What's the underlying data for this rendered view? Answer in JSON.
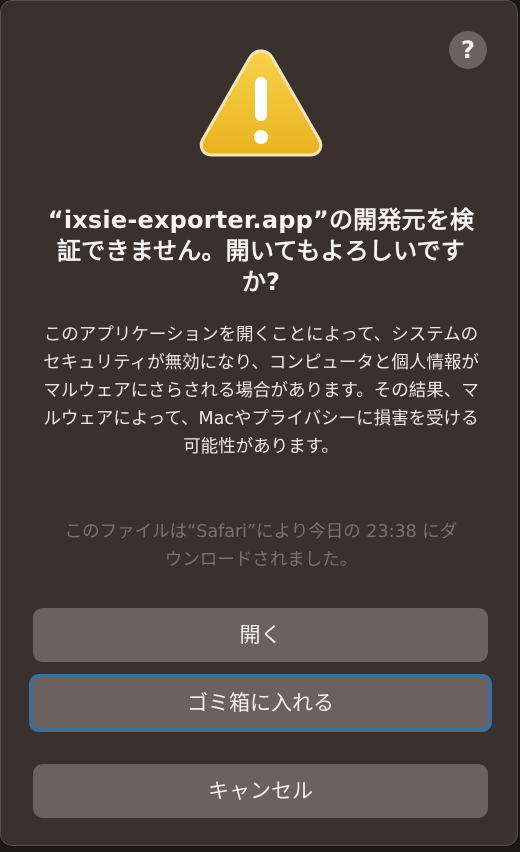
{
  "dialog": {
    "title": "“ixsie-exporter.app”の開発元を検証できません。開いてもよろしいですか?",
    "message": "このアプリケーションを開くことによって、システムのセキュリティが無効になり、コンピュータと個人情報がマルウェアにさらされる場合があります。その結果、マルウェアによって、Macやプライバシーに損害を受ける可能性があります。",
    "source_note": "このファイルは“Safari”により今日の 23:38 にダウンロードされました。",
    "help_label": "?",
    "buttons": {
      "open": "開く",
      "move_to_trash": "ゴミ箱に入れる",
      "cancel": "キャンセル"
    }
  },
  "colors": {
    "dialog_bg": "#3a302d",
    "button_bg": "#6b625f",
    "focus_ring": "#3c6f9c",
    "warning_yellow": "#f2c12e"
  },
  "icons": {
    "warning": "warning-triangle-icon",
    "help": "question-mark-icon"
  }
}
